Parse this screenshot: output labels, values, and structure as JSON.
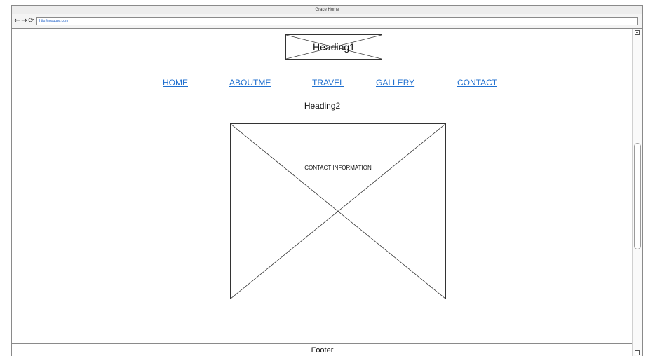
{
  "window": {
    "title": "Grace Home"
  },
  "toolbar": {
    "back_icon": "←",
    "forward_icon": "→",
    "reload_icon": "⟳",
    "url": "http://moqups.com"
  },
  "page": {
    "heading1": "Heading1",
    "nav": [
      "HOME",
      "ABOUTME",
      "TRAVEL",
      "GALLERY",
      "CONTACT"
    ],
    "heading2": "Heading2",
    "contact_label": "CONTACT INFORMATION",
    "footer": "Footer"
  },
  "colors": {
    "link": "#1f6fcf",
    "border": "#8a8a8a"
  }
}
